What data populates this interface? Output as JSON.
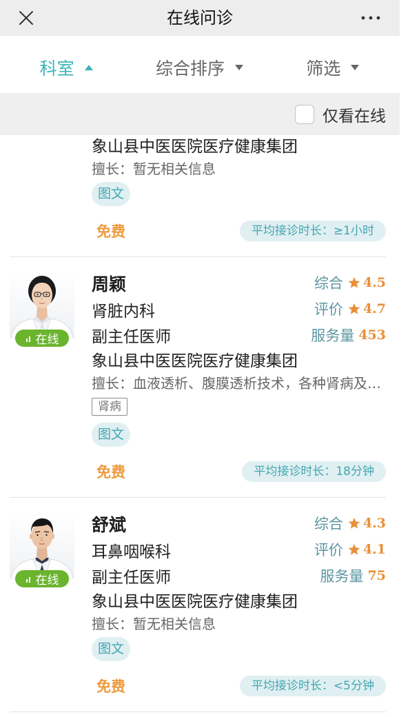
{
  "header": {
    "close_icon": "close-icon",
    "title": "在线问诊",
    "more_icon": "more-icon"
  },
  "tabs": [
    {
      "label": "科室",
      "arrow_icon": "caret-up-icon",
      "active": true
    },
    {
      "label": "综合排序",
      "arrow_icon": "caret-down-icon",
      "active": false
    },
    {
      "label": "筛选",
      "arrow_icon": "caret-down-icon",
      "active": false
    }
  ],
  "filter": {
    "online_only_label": "仅看在线",
    "online_only_checked": false
  },
  "colors": {
    "accent": "#3cb4b7",
    "tab_inactive": "#666666",
    "header_bg": "#ededed",
    "filter_bg": "#efefef",
    "price": "#ee9a3c",
    "online": "#6ab42e",
    "stat_label": "#5c96a2",
    "stat_value": "#e88f37",
    "pill_bg": "#e0eff2",
    "pill_text": "#43a7b1"
  },
  "doctors": [
    {
      "hospital": "象山县中医医院医疗健康集团",
      "specialty": "擅长：暂无相关信息",
      "service_tag": "图文",
      "price": "免费",
      "avg_response": "平均接诊时长：≥1小时"
    },
    {
      "name": "周颖",
      "department": "肾脏内科",
      "title": "副主任医师",
      "status": "在线",
      "stats": [
        {
          "label": "综合",
          "icon": "star-icon",
          "value": 4.5
        },
        {
          "label": "评价",
          "icon": "star-icon",
          "value": 4.7
        },
        {
          "label": "服务量",
          "value": 453
        }
      ],
      "hospital": "象山县中医医院医疗健康集团",
      "specialty": "擅长：血液透析、腹膜透析技术，各种肾病及…",
      "disease_tags": [
        "肾病"
      ],
      "service_tag": "图文",
      "price": "免费",
      "avg_response": "平均接诊时长：18分钟"
    },
    {
      "name": "舒斌",
      "department": "耳鼻咽喉科",
      "title": "副主任医师",
      "status": "在线",
      "stats": [
        {
          "label": "综合",
          "icon": "star-icon",
          "value": 4.3
        },
        {
          "label": "评价",
          "icon": "star-icon",
          "value": 4.1
        },
        {
          "label": "服务量",
          "value": 75
        }
      ],
      "hospital": "象山县中医医院医疗健康集团",
      "specialty": "擅长：暂无相关信息",
      "service_tag": "图文",
      "price": "免费",
      "avg_response": "平均接诊时长：<5分钟"
    }
  ]
}
